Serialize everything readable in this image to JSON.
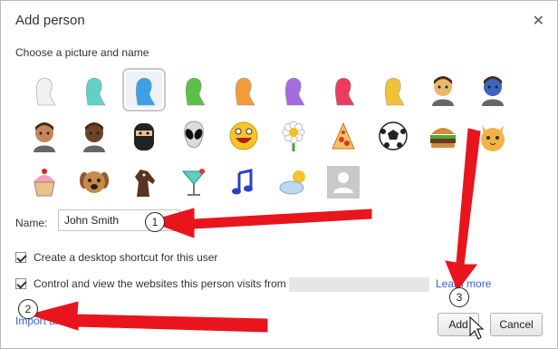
{
  "dialog": {
    "title": "Add person",
    "close_glyph": "✕",
    "subtitle": "Choose a picture and name"
  },
  "avatars": [
    {
      "name": "white-silhouette-avatar",
      "color": "#f1f1f1",
      "selected": false
    },
    {
      "name": "teal-silhouette-avatar",
      "color": "#5fd2c8",
      "selected": false
    },
    {
      "name": "blue-silhouette-avatar",
      "color": "#3aa0e8",
      "selected": true
    },
    {
      "name": "green-silhouette-avatar",
      "color": "#5cc04a",
      "selected": false
    },
    {
      "name": "orange-silhouette-avatar",
      "color": "#f29a3c",
      "selected": false
    },
    {
      "name": "purple-silhouette-avatar",
      "color": "#a56be0",
      "selected": false
    },
    {
      "name": "red-silhouette-avatar",
      "color": "#ea3d5e",
      "selected": false
    },
    {
      "name": "yellow-silhouette-avatar",
      "color": "#f0c23a",
      "selected": false
    },
    {
      "name": "businesswoman-avatar",
      "color": "#e9b870",
      "selected": false
    },
    {
      "name": "superhero-avatar",
      "color": "#3a66c2",
      "selected": false
    },
    {
      "name": "woman-sunglasses-avatar",
      "color": "#c4875c",
      "selected": false
    },
    {
      "name": "man-avatar",
      "color": "#6e4429",
      "selected": false
    },
    {
      "name": "ninja-avatar",
      "color": "#222222",
      "selected": false
    },
    {
      "name": "alien-avatar",
      "color": "#dcdcdc",
      "selected": false
    },
    {
      "name": "smiley-avatar",
      "color": "#f6c42a",
      "selected": false
    },
    {
      "name": "flower-avatar",
      "color": "#f4f4f4",
      "selected": false
    },
    {
      "name": "pizza-avatar",
      "color": "#f2c160",
      "selected": false
    },
    {
      "name": "soccer-ball-avatar",
      "color": "#f8f8f8",
      "selected": false
    },
    {
      "name": "burger-avatar",
      "color": "#c07a3a",
      "selected": false
    },
    {
      "name": "cat-avatar",
      "color": "#f2b347",
      "selected": false
    },
    {
      "name": "cupcake-avatar",
      "color": "#f5a0c0",
      "selected": false
    },
    {
      "name": "dog-avatar",
      "color": "#c8894a",
      "selected": false
    },
    {
      "name": "horse-avatar",
      "color": "#5a3420",
      "selected": false
    },
    {
      "name": "cocktail-avatar",
      "color": "#5fd0c0",
      "selected": false
    },
    {
      "name": "music-note-avatar",
      "color": "#2a3fc8",
      "selected": false
    },
    {
      "name": "sun-cloud-avatar",
      "color": "#bcd8f0",
      "selected": false
    },
    {
      "name": "generic-user-avatar",
      "color": "#c9c9c9",
      "selected": false
    }
  ],
  "name_field": {
    "label": "Name:",
    "value": "John Smith"
  },
  "options": {
    "desktop_shortcut_label": "Create a desktop shortcut for this user",
    "supervise_label": "Control and view the websites this person visits from",
    "learn_more": "Learn more",
    "import_link": "Import an existing"
  },
  "buttons": {
    "add": "Add",
    "cancel": "Cancel"
  },
  "callouts": {
    "one": "1",
    "two": "2",
    "three": "3",
    "arrow_color": "#e8141e"
  }
}
